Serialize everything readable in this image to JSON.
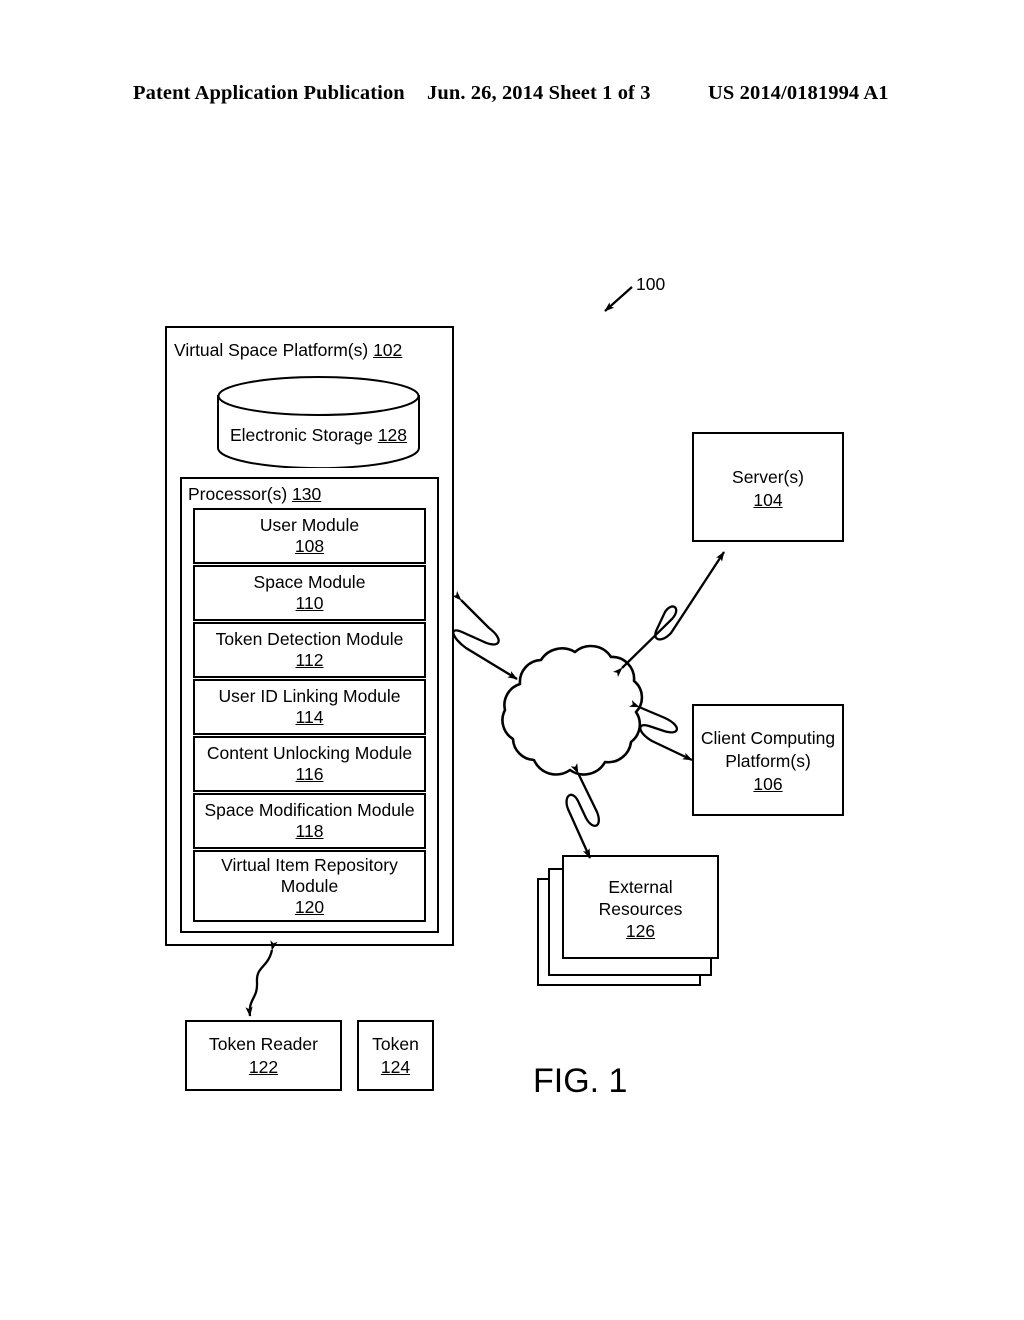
{
  "header": {
    "left": "Patent Application Publication",
    "middle": "Jun. 26, 2014  Sheet 1 of 3",
    "right": "US 2014/0181994 A1"
  },
  "figure": {
    "caption": "FIG. 1",
    "system_callout": "100"
  },
  "platform": {
    "title_text": "Virtual Space Platform(s) ",
    "title_ref": "102",
    "storage": {
      "label": "Electronic Storage ",
      "ref": "128"
    },
    "processor": {
      "title_text": "Processor(s) ",
      "ref": "130"
    },
    "modules": [
      {
        "name": "User Module",
        "ref": "108"
      },
      {
        "name": "Space Module",
        "ref": "110"
      },
      {
        "name": "Token Detection Module",
        "ref": "112"
      },
      {
        "name": "User ID Linking Module",
        "ref": "114"
      },
      {
        "name": "Content Unlocking Module",
        "ref": "116"
      },
      {
        "name": "Space Modification Module",
        "ref": "118"
      },
      {
        "name": "Virtual Item Repository Module",
        "ref": "120"
      }
    ]
  },
  "server": {
    "name": "Server(s)",
    "ref": "104"
  },
  "client": {
    "name_line1": "Client Computing",
    "name_line2": "Platform(s)",
    "ref": "106"
  },
  "external_resources": {
    "name_line1": "External",
    "name_line2": "Resources",
    "ref": "126"
  },
  "token_reader": {
    "name": "Token Reader",
    "ref": "122"
  },
  "token": {
    "name": "Token",
    "ref": "124"
  },
  "network": {
    "name": "network-cloud"
  },
  "colors": {
    "ink": "#000000",
    "paper": "#ffffff"
  }
}
